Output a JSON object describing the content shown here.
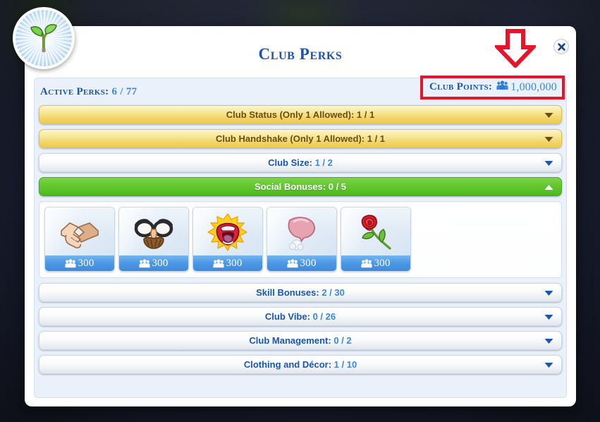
{
  "window": {
    "title": "Club Perks",
    "close_icon": "close-icon",
    "logo_icon": "plant-sprout-icon"
  },
  "stats": {
    "active_perks_label": "Active Perks:",
    "active_perks_value": "6 / 77",
    "club_points_label": "Club Points:",
    "club_points_value": "1,000,000",
    "club_points_icon": "club-points-people-icon",
    "highlight_color": "#e8152a"
  },
  "categories": [
    {
      "label": "Club Status (Only 1 Allowed):",
      "count": "1 / 1",
      "style": "gold",
      "expanded": false,
      "chevron": "chevron-down-icon"
    },
    {
      "label": "Club Handshake (Only 1 Allowed):",
      "count": "1 / 1",
      "style": "gold",
      "expanded": false,
      "chevron": "chevron-down-icon"
    },
    {
      "label": "Club Size:",
      "count": "1 / 2",
      "style": "plain",
      "expanded": false,
      "chevron": "chevron-down-icon"
    },
    {
      "label": "Social Bonuses:",
      "count": "0 / 5",
      "style": "green",
      "expanded": true,
      "chevron": "chevron-up-icon"
    },
    {
      "label": "Skill Bonuses:",
      "count": "2 / 30",
      "style": "plain",
      "expanded": false,
      "chevron": "chevron-down-icon"
    },
    {
      "label": "Club Vibe:",
      "count": "0 / 26",
      "style": "plain",
      "expanded": false,
      "chevron": "chevron-down-icon"
    },
    {
      "label": "Club Management:",
      "count": "0 / 2",
      "style": "plain",
      "expanded": false,
      "chevron": "chevron-down-icon"
    },
    {
      "label": "Clothing and Décor:",
      "count": "1 / 10",
      "style": "plain",
      "expanded": false,
      "chevron": "chevron-down-icon"
    }
  ],
  "social_bonus_perks": [
    {
      "icon": "handshake-icon",
      "price": "300"
    },
    {
      "icon": "disguise-glasses-icon",
      "price": "300"
    },
    {
      "icon": "shouting-mouth-icon",
      "price": "300"
    },
    {
      "icon": "whoopee-cushion-icon",
      "price": "300"
    },
    {
      "icon": "rose-icon",
      "price": "300"
    }
  ],
  "annotation": {
    "arrow_icon": "red-down-arrow-annotation",
    "color": "#e8152a"
  },
  "theme": {
    "title_blue": "#1b55b4",
    "value_blue": "#3a87e0",
    "gold": "#f2d469",
    "green": "#4cb91f",
    "price_blue": "#4e9ae6"
  }
}
